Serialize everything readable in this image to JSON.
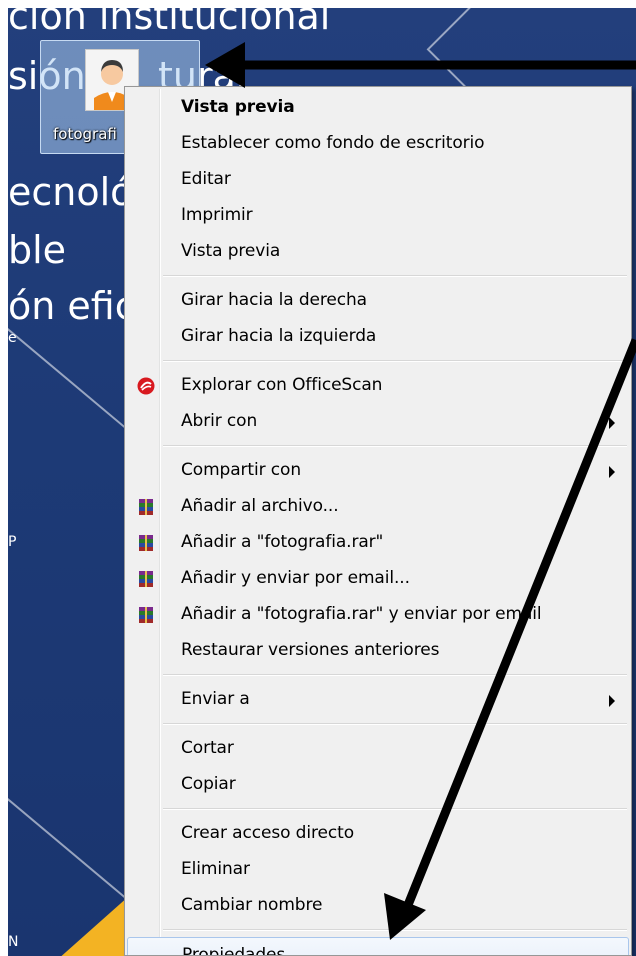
{
  "desktop": {
    "bg_texts": [
      "ción institucional",
      "sión",
      "tural",
      "ecnoló",
      "ble",
      "ón efic",
      "e",
      "P",
      "N"
    ]
  },
  "file_icon": {
    "label": "fotografi"
  },
  "context_menu": {
    "groups": [
      [
        {
          "label": "Vista previa",
          "bold": true
        },
        {
          "label": "Establecer como fondo de escritorio"
        },
        {
          "label": "Editar"
        },
        {
          "label": "Imprimir"
        },
        {
          "label": "Vista previa"
        }
      ],
      [
        {
          "label": "Girar hacia la derecha"
        },
        {
          "label": "Girar hacia la izquierda"
        }
      ],
      [
        {
          "label": "Explorar con OfficeScan",
          "icon": "officescan-icon"
        },
        {
          "label": "Abrir con",
          "submenu": true
        }
      ],
      [
        {
          "label": "Compartir con",
          "submenu": true
        },
        {
          "label": "Añadir al archivo...",
          "icon": "winrar-icon"
        },
        {
          "label": "Añadir a \"fotografia.rar\"",
          "icon": "winrar-icon"
        },
        {
          "label": "Añadir y enviar por email...",
          "icon": "winrar-icon"
        },
        {
          "label": "Añadir a \"fotografia.rar\" y enviar por email",
          "icon": "winrar-icon"
        },
        {
          "label": "Restaurar versiones anteriores"
        }
      ],
      [
        {
          "label": "Enviar a",
          "submenu": true
        }
      ],
      [
        {
          "label": "Cortar"
        },
        {
          "label": "Copiar"
        }
      ],
      [
        {
          "label": "Crear acceso directo"
        },
        {
          "label": "Eliminar"
        },
        {
          "label": "Cambiar nombre"
        }
      ],
      [
        {
          "label": "Propiedades",
          "highlighted": true
        }
      ]
    ]
  },
  "colors": {
    "desktop_blue": "#1f3c78",
    "accent_yellow": "#f3b323",
    "menu_bg": "#f0f0f0",
    "highlight_border": "#a9c6ec",
    "annotation_arrow": "#000000"
  }
}
